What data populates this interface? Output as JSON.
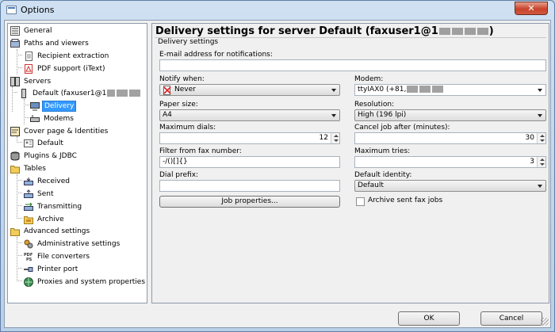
{
  "window": {
    "title": "Options",
    "close_glyph": "✕"
  },
  "tree": {
    "items": [
      {
        "label": "General",
        "icon": "list-icon"
      },
      {
        "label": "Paths and viewers",
        "icon": "folder-paths-icon"
      },
      {
        "label": "Recipient extraction",
        "icon": "document-icon"
      },
      {
        "label": "PDF support (iText)",
        "icon": "pdf-icon"
      },
      {
        "label": "Servers",
        "icon": "servers-icon"
      },
      {
        "label": "Default (faxuser1@1",
        "icon": "server-icon"
      },
      {
        "label": "Delivery",
        "icon": "monitor-icon"
      },
      {
        "label": "Modems",
        "icon": "modem-icon"
      },
      {
        "label": "Cover page & Identities",
        "icon": "cover-icon"
      },
      {
        "label": "Default",
        "icon": "identity-icon"
      },
      {
        "label": "Plugins & JDBC",
        "icon": "plugin-icon"
      },
      {
        "label": "Tables",
        "icon": "folder-icon"
      },
      {
        "label": "Received",
        "icon": "received-icon"
      },
      {
        "label": "Sent",
        "icon": "sent-icon"
      },
      {
        "label": "Transmitting",
        "icon": "transmitting-icon"
      },
      {
        "label": "Archive",
        "icon": "archive-icon"
      },
      {
        "label": "Advanced settings",
        "icon": "folder-icon"
      },
      {
        "label": "Administrative settings",
        "icon": "admin-icon"
      },
      {
        "label": "File converters",
        "icon": "converter-icon"
      },
      {
        "label": "Printer port",
        "icon": "printer-port-icon"
      },
      {
        "label": "Proxies and system properties",
        "icon": "globe-icon"
      }
    ]
  },
  "panel": {
    "title_prefix": "Delivery settings for server Default (faxuser1@1",
    "title_suffix": ")",
    "group_label": "Delivery settings",
    "email_label": "E-mail address for notifications:",
    "email_value": "",
    "notify_label": "Notify when:",
    "notify_value": "Never",
    "modem_label": "Modem:",
    "modem_value": "ttyIAX0 (+81,",
    "paper_label": "Paper size:",
    "paper_value": "A4",
    "resolution_label": "Resolution:",
    "resolution_value": "High (196 lpi)",
    "max_dials_label": "Maximum dials:",
    "max_dials_value": "12",
    "cancel_label": "Cancel job after (minutes):",
    "cancel_value": "30",
    "filter_label": "Filter from fax number:",
    "filter_value": "-/()[]{}",
    "max_tries_label": "Maximum tries:",
    "max_tries_value": "3",
    "dial_prefix_label": "Dial prefix:",
    "dial_prefix_value": "",
    "identity_label": "Default identity:",
    "identity_value": "Default",
    "job_props_label": "Job properties...",
    "archive_label": "Archive sent fax jobs"
  },
  "footer": {
    "ok_label": "OK",
    "cancel_label": "Cancel"
  }
}
